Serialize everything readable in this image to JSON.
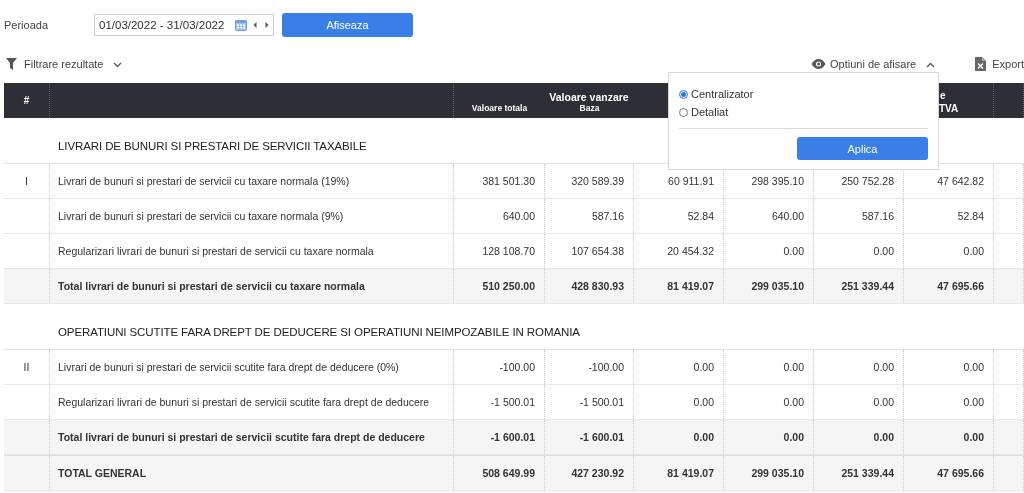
{
  "period": {
    "label": "Perioada",
    "value": "01/03/2022 - 31/03/2022"
  },
  "show_button": "Afiseaza",
  "filter": {
    "label": "Filtrare rezultate",
    "expanded": false
  },
  "display_options": {
    "label": "Optiuni de afisare",
    "expanded": true,
    "options": [
      {
        "label": "Centralizator",
        "selected": true
      },
      {
        "label": "Detaliat",
        "selected": false
      }
    ],
    "apply_button": "Aplica"
  },
  "export": {
    "label": "Export"
  },
  "table": {
    "header": {
      "number": "#",
      "group": "Valoare vanzare",
      "subheaders": [
        "Valoare totala",
        "Baza"
      ],
      "partial_top": "e",
      "partial_bottom": "TVA"
    },
    "sections": [
      {
        "title": "LIVRARI DE BUNURI SI PRESTARI DE SERVICII TAXABILE",
        "rows": [
          {
            "kind": "item",
            "number": "I",
            "label": "Livrari de bunuri si prestari de servicii cu taxare normala (19%)",
            "values": [
              "381 501.30",
              "320 589.39",
              "60 911.91",
              "298 395.10",
              "250 752.28",
              "47 642.82"
            ]
          },
          {
            "kind": "item",
            "label": "Livrari de bunuri si prestari de servicii cu taxare normala (9%)",
            "values": [
              "640.00",
              "587.16",
              "52.84",
              "640.00",
              "587.16",
              "52.84"
            ]
          },
          {
            "kind": "item",
            "label": "Regularizari livrari de bunuri si prestari de servicii cu taxare normala",
            "values": [
              "128 108.70",
              "107 654.38",
              "20 454.32",
              "0.00",
              "0.00",
              "0.00"
            ]
          },
          {
            "kind": "total",
            "label": "Total livrari de bunuri si prestari de servicii cu taxare normala",
            "values": [
              "510 250.00",
              "428 830.93",
              "81 419.07",
              "299 035.10",
              "251 339.44",
              "47 695.66"
            ]
          }
        ]
      },
      {
        "title": "OPERATIUNI SCUTITE FARA DREPT DE DEDUCERE SI OPERATIUNI NEIMPOZABILE IN ROMANIA",
        "rows": [
          {
            "kind": "item",
            "number": "II",
            "label": "Livrari de bunuri si prestari de servicii scutite fara drept de deducere (0%)",
            "values": [
              "-100.00",
              "-100.00",
              "0.00",
              "0.00",
              "0.00",
              "0.00"
            ]
          },
          {
            "kind": "item",
            "label": "Regularizari livrari de bunuri si prestari de servicii scutite fara drept de deducere",
            "values": [
              "-1 500.01",
              "-1 500.01",
              "0.00",
              "0.00",
              "0.00",
              "0.00"
            ]
          },
          {
            "kind": "total",
            "label": "Total livrari de bunuri si prestari de servicii scutite fara drept de deducere",
            "values": [
              "-1 600.01",
              "-1 600.01",
              "0.00",
              "0.00",
              "0.00",
              "0.00"
            ]
          }
        ]
      }
    ],
    "grand_total": {
      "label": "TOTAL GENERAL",
      "values": [
        "508 649.99",
        "427 230.92",
        "81 419.07",
        "299 035.10",
        "251 339.44",
        "47 695.66"
      ]
    }
  }
}
